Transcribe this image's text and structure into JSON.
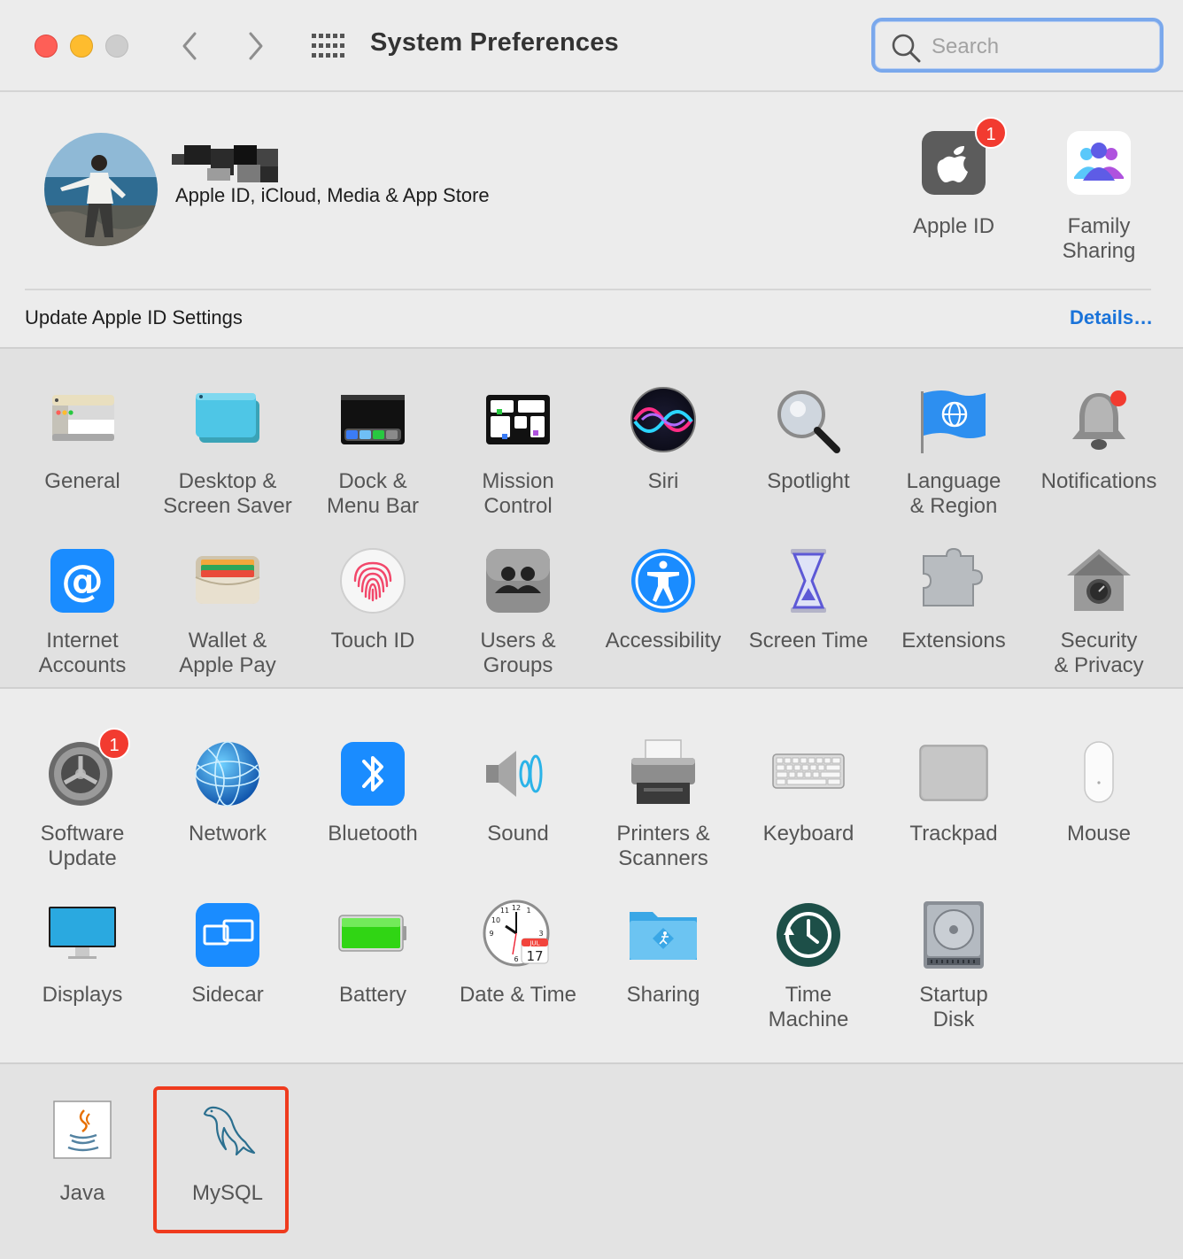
{
  "window": {
    "title": "System Preferences"
  },
  "search": {
    "placeholder": "Search"
  },
  "apple_id": {
    "subtitle": "Apple ID, iCloud, Media & App Store",
    "update_text": "Update Apple ID Settings",
    "details_link": "Details…"
  },
  "top_panes": [
    {
      "label": "Apple ID",
      "badge": "1"
    },
    {
      "label": "Family\nSharing"
    }
  ],
  "row1": [
    {
      "label": "General"
    },
    {
      "label": "Desktop &\nScreen Saver"
    },
    {
      "label": "Dock &\nMenu Bar"
    },
    {
      "label": "Mission\nControl"
    },
    {
      "label": "Siri"
    },
    {
      "label": "Spotlight"
    },
    {
      "label": "Language\n& Region"
    },
    {
      "label": "Notifications"
    }
  ],
  "row2": [
    {
      "label": "Internet\nAccounts"
    },
    {
      "label": "Wallet &\nApple Pay"
    },
    {
      "label": "Touch ID"
    },
    {
      "label": "Users &\nGroups"
    },
    {
      "label": "Accessibility"
    },
    {
      "label": "Screen Time"
    },
    {
      "label": "Extensions"
    },
    {
      "label": "Security\n& Privacy"
    }
  ],
  "row3": [
    {
      "label": "Software\nUpdate",
      "badge": "1"
    },
    {
      "label": "Network"
    },
    {
      "label": "Bluetooth"
    },
    {
      "label": "Sound"
    },
    {
      "label": "Printers &\nScanners"
    },
    {
      "label": "Keyboard"
    },
    {
      "label": "Trackpad"
    },
    {
      "label": "Mouse"
    }
  ],
  "row4": [
    {
      "label": "Displays"
    },
    {
      "label": "Sidecar"
    },
    {
      "label": "Battery"
    },
    {
      "label": "Date & Time",
      "calendar_month": "JUL",
      "calendar_day": "17"
    },
    {
      "label": "Sharing"
    },
    {
      "label": "Time\nMachine"
    },
    {
      "label": "Startup\nDisk"
    }
  ],
  "other": [
    {
      "label": "Java"
    },
    {
      "label": "MySQL"
    }
  ],
  "colors": {
    "accent": "#1a73d9",
    "badge": "#f23b30",
    "highlight": "#ef3b1e",
    "search_ring": "#7aa8ec"
  }
}
